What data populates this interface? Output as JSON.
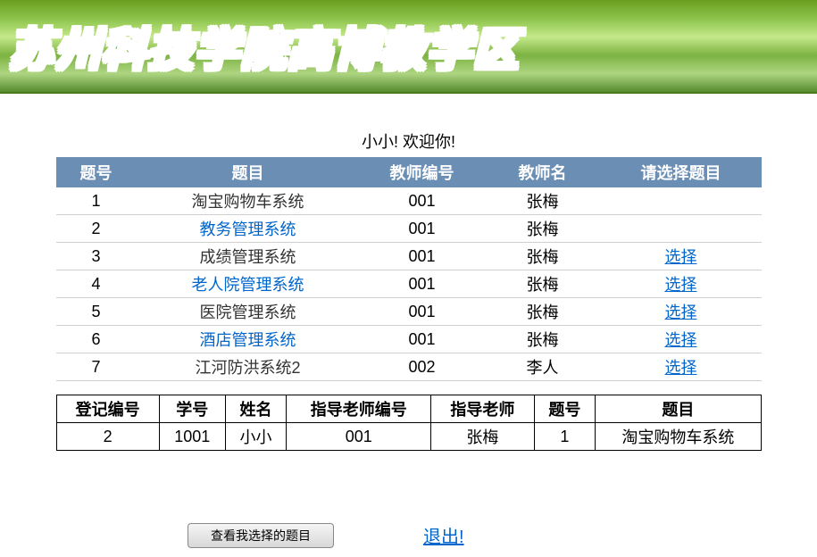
{
  "banner": {
    "title": "苏州科技学院高博教学区"
  },
  "welcome": "小小! 欢迎你!",
  "topics": {
    "headers": {
      "id": "题号",
      "title": "题目",
      "teacher_id": "教师编号",
      "teacher_name": "教师名",
      "select": "请选择题目"
    },
    "rows": [
      {
        "id": "1",
        "title": "淘宝购物车系统",
        "teacher_id": "001",
        "teacher_name": "张梅",
        "selectable": false,
        "link_style": "dark"
      },
      {
        "id": "2",
        "title": "教务管理系统",
        "teacher_id": "001",
        "teacher_name": "张梅",
        "selectable": false,
        "link_style": "blue"
      },
      {
        "id": "3",
        "title": "成绩管理系统",
        "teacher_id": "001",
        "teacher_name": "张梅",
        "selectable": true,
        "link_style": "dark"
      },
      {
        "id": "4",
        "title": "老人院管理系统",
        "teacher_id": "001",
        "teacher_name": "张梅",
        "selectable": true,
        "link_style": "blue"
      },
      {
        "id": "5",
        "title": "医院管理系统",
        "teacher_id": "001",
        "teacher_name": "张梅",
        "selectable": true,
        "link_style": "dark"
      },
      {
        "id": "6",
        "title": "酒店管理系统",
        "teacher_id": "001",
        "teacher_name": "张梅",
        "selectable": true,
        "link_style": "blue"
      },
      {
        "id": "7",
        "title": "江河防洪系统2",
        "teacher_id": "002",
        "teacher_name": "李人",
        "selectable": true,
        "link_style": "dark"
      }
    ],
    "select_label": "选择"
  },
  "registration": {
    "headers": {
      "reg_id": "登记编号",
      "student_id": "学号",
      "name": "姓名",
      "teacher_id": "指导老师编号",
      "teacher_name": "指导老师",
      "topic_id": "题号",
      "topic_title": "题目"
    },
    "row": {
      "reg_id": "2",
      "student_id": "1001",
      "name": "小小",
      "teacher_id": "001",
      "teacher_name": "张梅",
      "topic_id": "1",
      "topic_title": "淘宝购物车系统"
    }
  },
  "buttons": {
    "view_my_topic": "查看我选择的题目",
    "logout": "退出!"
  }
}
